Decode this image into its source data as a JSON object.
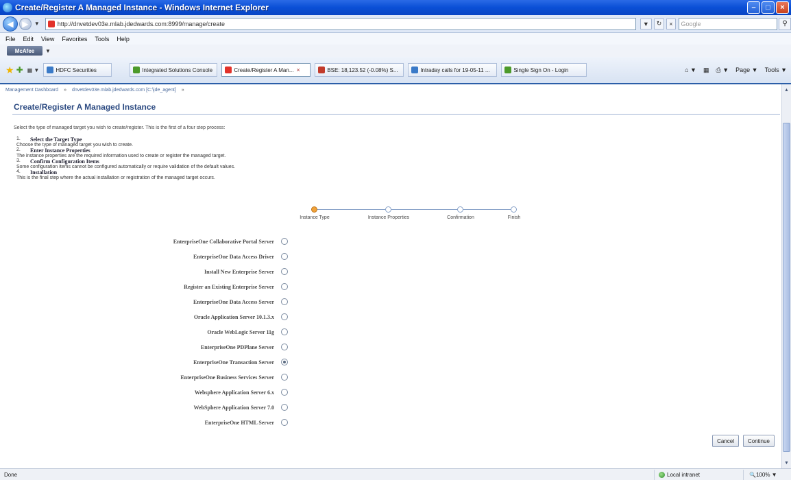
{
  "window": {
    "title": "Create/Register A Managed Instance - Windows Internet Explorer"
  },
  "address": {
    "url": "http://dnvetdev03e.mlab.jdedwards.com:8999/manage/create",
    "search_placeholder": "Google"
  },
  "menu": [
    "File",
    "Edit",
    "View",
    "Favorites",
    "Tools",
    "Help"
  ],
  "mcafee": {
    "label": "McAfee"
  },
  "favorites": {
    "item": "HDFC Securities"
  },
  "tabs": [
    {
      "label": "Integrated Solutions Console",
      "color": "#4c9a2a"
    },
    {
      "label": "Create/Register A Man...",
      "color": "#e2322a",
      "active": true
    },
    {
      "label": "BSE: 18,123.52 (-0.08%) S...",
      "color": "#c23a2a"
    },
    {
      "label": "Intraday calls for 19-05-11 ...",
      "color": "#3a7ac8"
    },
    {
      "label": "Single Sign On - Login",
      "color": "#4c9a2a"
    }
  ],
  "commandbar": {
    "page": "Page",
    "tools": "Tools"
  },
  "breadcrumb": [
    "Management Dashboard",
    "dnvetdev03e.mlab.jdedwards.com [C:\\jde_agent]"
  ],
  "page": {
    "title": "Create/Register A Managed Instance",
    "intro": "Select the type of managed target you wish to create/register. This is the first of a four step process:"
  },
  "steps": [
    {
      "num": "1.",
      "title": "Select the Target Type",
      "desc": "Choose the type of managed target you wish to create."
    },
    {
      "num": "2.",
      "title": "Enter Instance Properties",
      "desc": "The instance properties are the required information used to create or register the managed target."
    },
    {
      "num": "3.",
      "title": "Confirm Configuration Items",
      "desc": "Some configuration items cannot be configured automatically or require validation of the default values."
    },
    {
      "num": "4.",
      "title": "Installation",
      "desc": "This is the final step where the actual installation or registration of the managed target occurs."
    }
  ],
  "train": [
    "Instance Type",
    "Instance Properties",
    "Confirmation",
    "Finish"
  ],
  "options": [
    {
      "label": "EnterpriseOne Collaborative Portal Server",
      "checked": false
    },
    {
      "label": "EnterpriseOne Data Access Driver",
      "checked": false
    },
    {
      "label": "Install New Enterprise Server",
      "checked": false
    },
    {
      "label": "Register an Existing Enterprise Server",
      "checked": false
    },
    {
      "label": "EnterpriseOne Data Access Server",
      "checked": false
    },
    {
      "label": "Oracle Application Server 10.1.3.x",
      "checked": false
    },
    {
      "label": "Oracle WebLogic Server 11g",
      "checked": false
    },
    {
      "label": "EnterpriseOne PDPlane Server",
      "checked": false
    },
    {
      "label": "EnterpriseOne Transaction Server",
      "checked": true
    },
    {
      "label": "EnterpriseOne Business Services Server",
      "checked": false
    },
    {
      "label": "Websphere Application Server 6.x",
      "checked": false
    },
    {
      "label": "WebSphere Application Server 7.0",
      "checked": false
    },
    {
      "label": "EnterpriseOne HTML Server",
      "checked": false
    }
  ],
  "buttons": {
    "cancel": "Cancel",
    "continue": "Continue"
  },
  "status": {
    "text": "Done",
    "zone": "Local intranet",
    "zoom": "100%"
  }
}
